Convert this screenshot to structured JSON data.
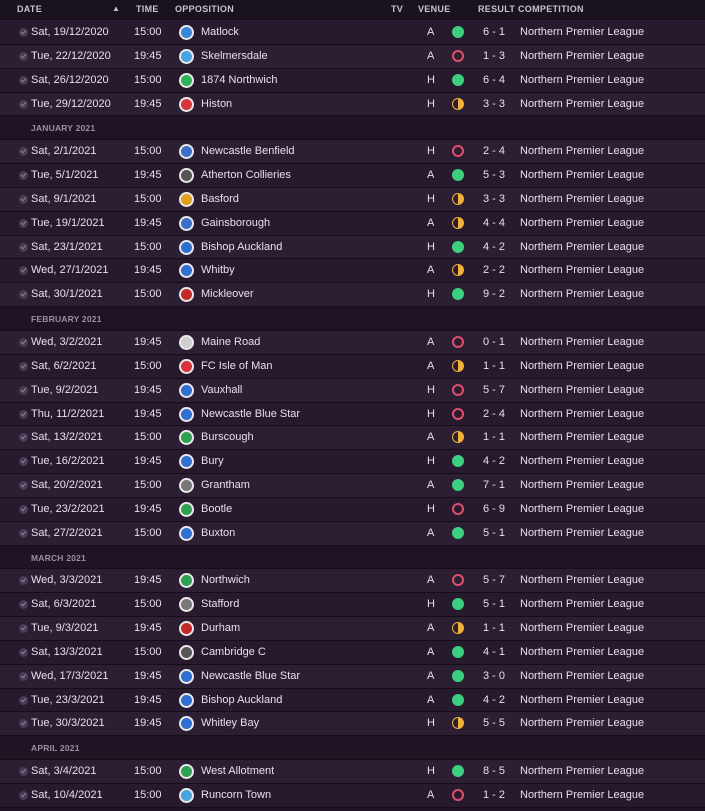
{
  "header": {
    "date": "DATE",
    "sort_icon": "▲",
    "time": "TIME",
    "opposition": "OPPOSITION",
    "tv": "TV",
    "venue": "VENUE",
    "result": "RESULT",
    "competition": "COMPETITION"
  },
  "rows": [
    {
      "type": "match",
      "date": "Sat, 19/12/2020",
      "time": "15:00",
      "opp": "Matlock",
      "crest": "#3a86d6",
      "venue": "A",
      "res": "W",
      "score": "6 - 1",
      "comp": "Northern Premier League"
    },
    {
      "type": "match",
      "date": "Tue, 22/12/2020",
      "time": "19:45",
      "opp": "Skelmersdale",
      "crest": "#4aa3e0",
      "venue": "A",
      "res": "L",
      "score": "1 - 3",
      "comp": "Northern Premier League"
    },
    {
      "type": "match",
      "date": "Sat, 26/12/2020",
      "time": "15:00",
      "opp": "1874 Northwich",
      "crest": "#2fb25a",
      "venue": "H",
      "res": "W",
      "score": "6 - 4",
      "comp": "Northern Premier League"
    },
    {
      "type": "match",
      "date": "Tue, 29/12/2020",
      "time": "19:45",
      "opp": "Histon",
      "crest": "#d8343c",
      "venue": "H",
      "res": "D",
      "score": "3 - 3",
      "comp": "Northern Premier League"
    },
    {
      "type": "month",
      "label": "JANUARY 2021"
    },
    {
      "type": "match",
      "date": "Sat, 2/1/2021",
      "time": "15:00",
      "opp": "Newcastle Benfield",
      "crest": "#3b6fc9",
      "venue": "H",
      "res": "L",
      "score": "2 - 4",
      "comp": "Northern Premier League"
    },
    {
      "type": "match",
      "date": "Tue, 5/1/2021",
      "time": "19:45",
      "opp": "Atherton Collieries",
      "crest": "#555555",
      "venue": "A",
      "res": "W",
      "score": "5 - 3",
      "comp": "Northern Premier League"
    },
    {
      "type": "match",
      "date": "Sat, 9/1/2021",
      "time": "15:00",
      "opp": "Basford",
      "crest": "#e0a020",
      "venue": "H",
      "res": "D",
      "score": "3 - 3",
      "comp": "Northern Premier League"
    },
    {
      "type": "match",
      "date": "Tue, 19/1/2021",
      "time": "19:45",
      "opp": "Gainsborough",
      "crest": "#3b6fc9",
      "venue": "A",
      "res": "D",
      "score": "4 - 4",
      "comp": "Northern Premier League"
    },
    {
      "type": "match",
      "date": "Sat, 23/1/2021",
      "time": "15:00",
      "opp": "Bishop Auckland",
      "crest": "#2f6fd0",
      "venue": "H",
      "res": "W",
      "score": "4 - 2",
      "comp": "Northern Premier League"
    },
    {
      "type": "match",
      "date": "Wed, 27/1/2021",
      "time": "19:45",
      "opp": "Whitby",
      "crest": "#2f6fd0",
      "venue": "A",
      "res": "D",
      "score": "2 - 2",
      "comp": "Northern Premier League"
    },
    {
      "type": "match",
      "date": "Sat, 30/1/2021",
      "time": "15:00",
      "opp": "Mickleover",
      "crest": "#c42828",
      "venue": "H",
      "res": "W",
      "score": "9 - 2",
      "comp": "Northern Premier League"
    },
    {
      "type": "month",
      "label": "FEBRUARY 2021"
    },
    {
      "type": "match",
      "date": "Wed, 3/2/2021",
      "time": "19:45",
      "opp": "Maine Road",
      "crest": "#cfcfcf",
      "venue": "A",
      "res": "L",
      "score": "0 - 1",
      "comp": "Northern Premier League"
    },
    {
      "type": "match",
      "date": "Sat, 6/2/2021",
      "time": "15:00",
      "opp": "FC Isle of Man",
      "crest": "#d8343c",
      "venue": "A",
      "res": "D",
      "score": "1 - 1",
      "comp": "Northern Premier League"
    },
    {
      "type": "match",
      "date": "Tue, 9/2/2021",
      "time": "19:45",
      "opp": "Vauxhall",
      "crest": "#2f6fd0",
      "venue": "H",
      "res": "L",
      "score": "5 - 7",
      "comp": "Northern Premier League"
    },
    {
      "type": "match",
      "date": "Thu, 11/2/2021",
      "time": "19:45",
      "opp": "Newcastle Blue Star",
      "crest": "#2f6fd0",
      "venue": "H",
      "res": "L",
      "score": "2 - 4",
      "comp": "Northern Premier League"
    },
    {
      "type": "match",
      "date": "Sat, 13/2/2021",
      "time": "15:00",
      "opp": "Burscough",
      "crest": "#2fa050",
      "venue": "A",
      "res": "D",
      "score": "1 - 1",
      "comp": "Northern Premier League"
    },
    {
      "type": "match",
      "date": "Tue, 16/2/2021",
      "time": "19:45",
      "opp": "Bury",
      "crest": "#2f6fd0",
      "venue": "H",
      "res": "W",
      "score": "4 - 2",
      "comp": "Northern Premier League"
    },
    {
      "type": "match",
      "date": "Sat, 20/2/2021",
      "time": "15:00",
      "opp": "Grantham",
      "crest": "#777777",
      "venue": "A",
      "res": "W",
      "score": "7 - 1",
      "comp": "Northern Premier League"
    },
    {
      "type": "match",
      "date": "Tue, 23/2/2021",
      "time": "19:45",
      "opp": "Bootle",
      "crest": "#2fa050",
      "venue": "H",
      "res": "L",
      "score": "6 - 9",
      "comp": "Northern Premier League"
    },
    {
      "type": "match",
      "date": "Sat, 27/2/2021",
      "time": "15:00",
      "opp": "Buxton",
      "crest": "#2f6fd0",
      "venue": "A",
      "res": "W",
      "score": "5 - 1",
      "comp": "Northern Premier League"
    },
    {
      "type": "month",
      "label": "MARCH 2021"
    },
    {
      "type": "match",
      "date": "Wed, 3/3/2021",
      "time": "19:45",
      "opp": "Northwich",
      "crest": "#2fa050",
      "venue": "A",
      "res": "L",
      "score": "5 - 7",
      "comp": "Northern Premier League"
    },
    {
      "type": "match",
      "date": "Sat, 6/3/2021",
      "time": "15:00",
      "opp": "Stafford",
      "crest": "#777777",
      "venue": "H",
      "res": "W",
      "score": "5 - 1",
      "comp": "Northern Premier League"
    },
    {
      "type": "match",
      "date": "Tue, 9/3/2021",
      "time": "19:45",
      "opp": "Durham",
      "crest": "#c42828",
      "venue": "A",
      "res": "D",
      "score": "1 - 1",
      "comp": "Northern Premier League"
    },
    {
      "type": "match",
      "date": "Sat, 13/3/2021",
      "time": "15:00",
      "opp": "Cambridge C",
      "crest": "#555555",
      "venue": "A",
      "res": "W",
      "score": "4 - 1",
      "comp": "Northern Premier League"
    },
    {
      "type": "match",
      "date": "Wed, 17/3/2021",
      "time": "19:45",
      "opp": "Newcastle Blue Star",
      "crest": "#2f6fd0",
      "venue": "A",
      "res": "W",
      "score": "3 - 0",
      "comp": "Northern Premier League"
    },
    {
      "type": "match",
      "date": "Tue, 23/3/2021",
      "time": "19:45",
      "opp": "Bishop Auckland",
      "crest": "#2f6fd0",
      "venue": "A",
      "res": "W",
      "score": "4 - 2",
      "comp": "Northern Premier League"
    },
    {
      "type": "match",
      "date": "Tue, 30/3/2021",
      "time": "19:45",
      "opp": "Whitley Bay",
      "crest": "#2f6fd0",
      "venue": "H",
      "res": "D",
      "score": "5 - 5",
      "comp": "Northern Premier League"
    },
    {
      "type": "month",
      "label": "APRIL 2021"
    },
    {
      "type": "match",
      "date": "Sat, 3/4/2021",
      "time": "15:00",
      "opp": "West Allotment",
      "crest": "#2fa050",
      "venue": "H",
      "res": "W",
      "score": "8 - 5",
      "comp": "Northern Premier League"
    },
    {
      "type": "match",
      "date": "Sat, 10/4/2021",
      "time": "15:00",
      "opp": "Runcorn Town",
      "crest": "#4aa3e0",
      "venue": "A",
      "res": "L",
      "score": "1 - 2",
      "comp": "Northern Premier League"
    }
  ]
}
